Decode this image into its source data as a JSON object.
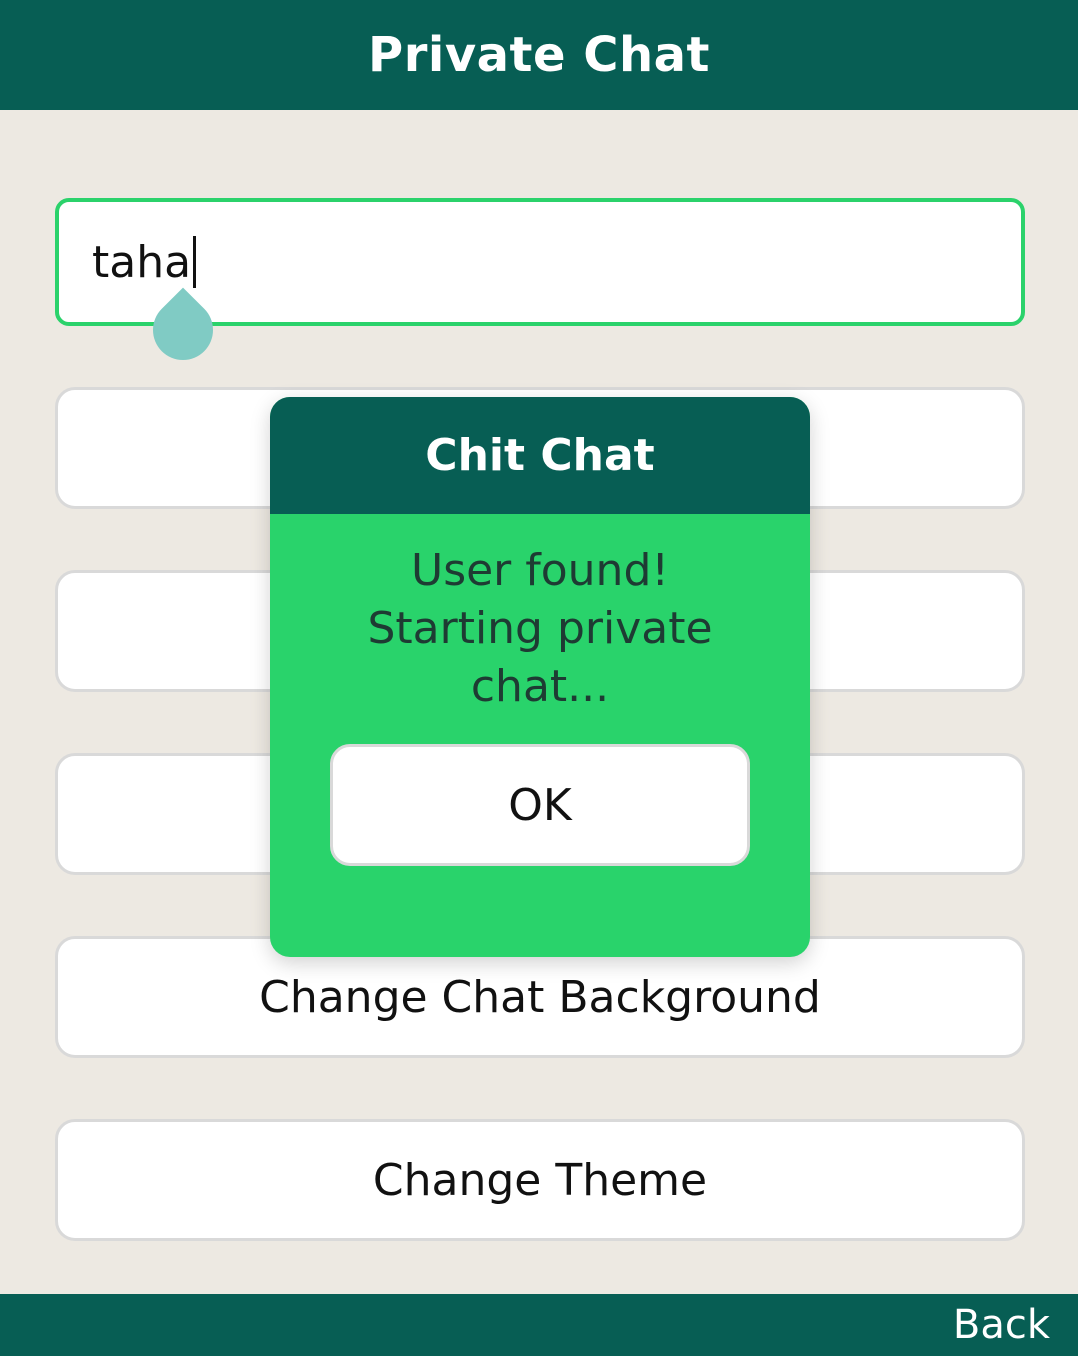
{
  "header": {
    "title": "Private Chat",
    "background_color": "#075E54"
  },
  "username_input": {
    "value": "taha",
    "border_color": "#2BD26B"
  },
  "menu": {
    "items": [
      {
        "label": ""
      },
      {
        "label": ""
      },
      {
        "label": ""
      },
      {
        "label": "Change Chat Background"
      },
      {
        "label": "Change Theme"
      }
    ]
  },
  "dialog": {
    "title": "Chit Chat",
    "message_lines": [
      "User found!",
      "Starting private",
      "chat..."
    ],
    "ok_label": "OK",
    "body_color": "#29D36B",
    "header_color": "#075E54"
  },
  "footer": {
    "back_label": "Back"
  }
}
